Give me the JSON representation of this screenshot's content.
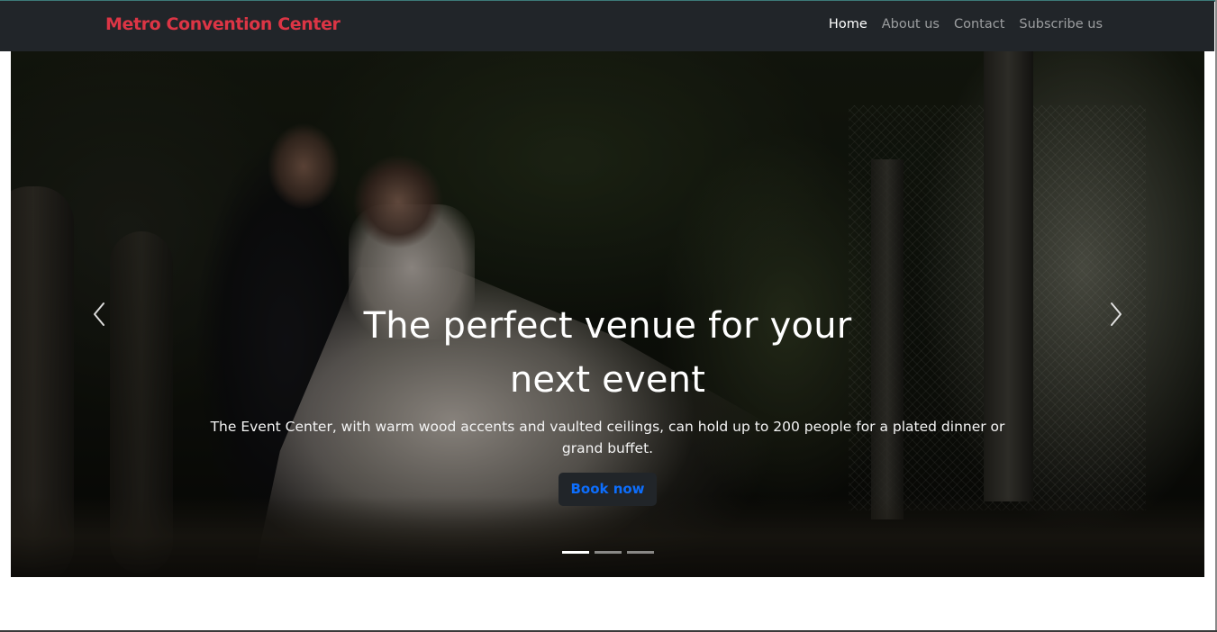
{
  "navbar": {
    "brand": "Metro Convention Center",
    "links": [
      {
        "label": "Home",
        "active": true
      },
      {
        "label": "About us",
        "active": false
      },
      {
        "label": "Contact",
        "active": false
      },
      {
        "label": "Subscribe us",
        "active": false
      }
    ]
  },
  "hero": {
    "title_line1": "The perfect venue for your",
    "title_line2": "next event",
    "description": "The Event Center, with warm wood accents and vaulted ceilings, can hold up to 200 people for a plated dinner or grand buffet.",
    "button_label": "Book now",
    "slide_count": 3,
    "active_slide": 1
  },
  "colors": {
    "navbar_bg": "#212529",
    "brand": "#dc3545",
    "button_text": "#0d6efd",
    "button_bg": "#212529"
  },
  "icons": {
    "prev": "chevron-left-icon",
    "next": "chevron-right-icon"
  }
}
